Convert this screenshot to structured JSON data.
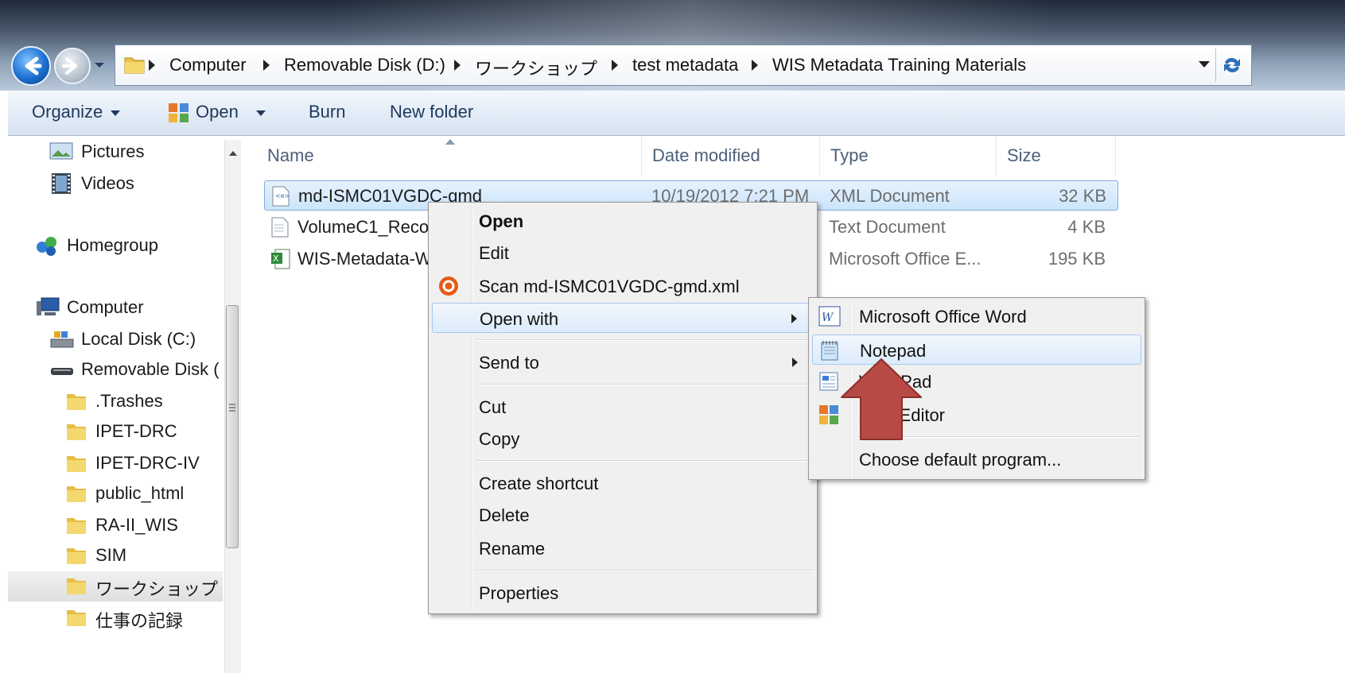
{
  "address": {
    "breadcrumbs": [
      "Computer",
      "Removable Disk (D:)",
      "ワークショップ",
      "test metadata",
      "WIS Metadata Training Materials"
    ]
  },
  "toolbar": {
    "organize": "Organize",
    "open": "Open",
    "burn": "Burn",
    "new_folder": "New folder"
  },
  "nav": {
    "items": [
      "Pictures",
      "Videos",
      "Homegroup",
      "Computer",
      "Local Disk (C:)",
      "Removable Disk (",
      ".Trashes",
      "IPET-DRC",
      "IPET-DRC-IV",
      "public_html",
      "RA-II_WIS",
      "SIM",
      "ワークショップ",
      "仕事の記録"
    ]
  },
  "columns": {
    "name": "Name",
    "date": "Date modified",
    "type": "Type",
    "size": "Size"
  },
  "files": [
    {
      "name": "md-ISMC01VGDC-gmd",
      "date": "10/19/2012 7:21 PM",
      "type": "XML Document",
      "size": "32 KB"
    },
    {
      "name": "VolumeC1_Reco",
      "date": "",
      "type": "Text Document",
      "size": "4 KB"
    },
    {
      "name": "WIS-Metadata-W",
      "date": "",
      "type": "Microsoft Office E...",
      "size": "195 KB"
    }
  ],
  "context_menu": {
    "open": "Open",
    "edit": "Edit",
    "scan": "Scan md-ISMC01VGDC-gmd.xml",
    "open_with": "Open with",
    "send_to": "Send to",
    "cut": "Cut",
    "copy": "Copy",
    "create_shortcut": "Create shortcut",
    "delete": "Delete",
    "rename": "Rename",
    "properties": "Properties"
  },
  "open_with_menu": {
    "word": "Microsoft Office Word",
    "notepad": "Notepad",
    "wordpad": "WordPad",
    "xml_editor": "XML Editor",
    "choose_default": "Choose default program..."
  },
  "colors": {
    "accent": "#1e395b",
    "selection": "#cbe5fb",
    "menu_bg": "#f0f0f0",
    "pointer_arrow": "#b84a45"
  }
}
